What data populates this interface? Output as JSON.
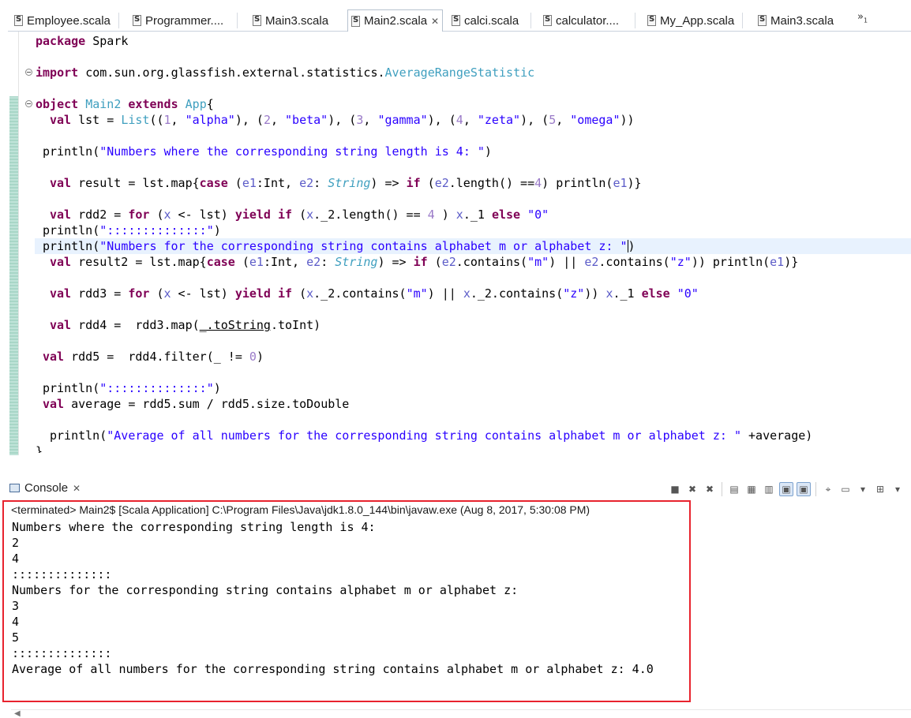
{
  "tabs": [
    {
      "label": "Employee.scala"
    },
    {
      "label": "Programmer...."
    },
    {
      "label": "Main3.scala"
    },
    {
      "label": "Main2.scala",
      "active": true
    },
    {
      "label": "calci.scala"
    },
    {
      "label": "calculator...."
    },
    {
      "label": "My_App.scala"
    },
    {
      "label": "Main3.scala"
    }
  ],
  "tab_overflow": {
    "chevron": "»",
    "count": "1"
  },
  "code": {
    "l1": [
      "package",
      " Spark"
    ],
    "l2": [
      "import",
      " com.sun.org.glassfish.external.statistics.",
      "AverageRangeStatistic"
    ],
    "l3": [
      "object",
      " ",
      "Main2",
      " ",
      "extends",
      " ",
      "App",
      "{"
    ],
    "l4": [
      "val",
      " lst = ",
      "List",
      "((",
      "1",
      ", ",
      "\"alpha\"",
      "), (",
      "2",
      ", ",
      "\"beta\"",
      "), (",
      "3",
      ", ",
      "\"gamma\"",
      "), (",
      "4",
      ", ",
      "\"zeta\"",
      "), (",
      "5",
      ", ",
      "\"omega\"",
      "))"
    ],
    "l5": [
      "println(",
      "\"Numbers where the corresponding string length is 4: \"",
      ")"
    ],
    "l6": [
      "val",
      " result = lst.map{",
      "case",
      " (",
      "e1",
      ":Int, ",
      "e2",
      ": ",
      "String",
      ") => ",
      "if",
      " (",
      "e2",
      ".length() ==",
      "4",
      ") println(",
      "e1",
      ")}"
    ],
    "l7": [
      "val",
      " rdd2 = ",
      "for",
      " (",
      "x",
      " <- lst) ",
      "yield",
      " ",
      "if",
      " (",
      "x",
      "._2.length() == ",
      "4",
      " ) ",
      "x",
      "._1 ",
      "else",
      " ",
      "\"0\""
    ],
    "l8": [
      "println(",
      "\"::::::::::::::\"",
      ")"
    ],
    "l9": [
      "println(",
      "\"Numbers for the corresponding string contains alphabet m or alphabet z: \"",
      ")"
    ],
    "l10": [
      "val",
      " result2 = lst.map{",
      "case",
      " (",
      "e1",
      ":Int, ",
      "e2",
      ": ",
      "String",
      ") => ",
      "if",
      " (",
      "e2",
      ".contains(",
      "\"m\"",
      ") || ",
      "e2",
      ".contains(",
      "\"z\"",
      ")) println(",
      "e1",
      ")}"
    ],
    "l11": [
      "val",
      " rdd3 = ",
      "for",
      " (",
      "x",
      " <- lst) ",
      "yield",
      " ",
      "if",
      " (",
      "x",
      "._2.contains(",
      "\"m\"",
      ") || ",
      "x",
      "._2.contains(",
      "\"z\"",
      ")) ",
      "x",
      "._1 ",
      "else",
      " ",
      "\"0\""
    ],
    "l12": [
      "val",
      " rdd4 =  rdd3.map(",
      "_.toString",
      ".toInt)"
    ],
    "l13": [
      "val",
      " rdd5 =  rdd4.filter(_ != ",
      "0",
      ")"
    ],
    "l14": [
      "println(",
      "\"::::::::::::::\"",
      ")"
    ],
    "l15": [
      "val",
      " average = rdd5.sum / rdd5.size.toDouble"
    ],
    "l16": [
      "println(",
      "\"Average of all numbers for the corresponding string contains alphabet m or alphabet z: \"",
      " +average)"
    ],
    "l17": [
      "}"
    ]
  },
  "console": {
    "tab_label": "Console",
    "status": "<terminated> Main2$ [Scala Application] C:\\Program Files\\Java\\jdk1.8.0_144\\bin\\javaw.exe (Aug 8, 2017, 5:30:08 PM)",
    "output": [
      "Numbers where the corresponding string length is 4:",
      "2",
      "4",
      "::::::::::::::",
      "Numbers for the corresponding string contains alphabet m or alphabet z:",
      "3",
      "4",
      "5",
      "::::::::::::::",
      "Average of all numbers for the corresponding string contains alphabet m or alphabet z: 4.0"
    ]
  },
  "colors": {
    "keyword": "#7f0055",
    "string": "#2a00ff",
    "number": "#9a7ac8",
    "type": "#3f9fbf",
    "highlight_frame": "#e8232e"
  }
}
